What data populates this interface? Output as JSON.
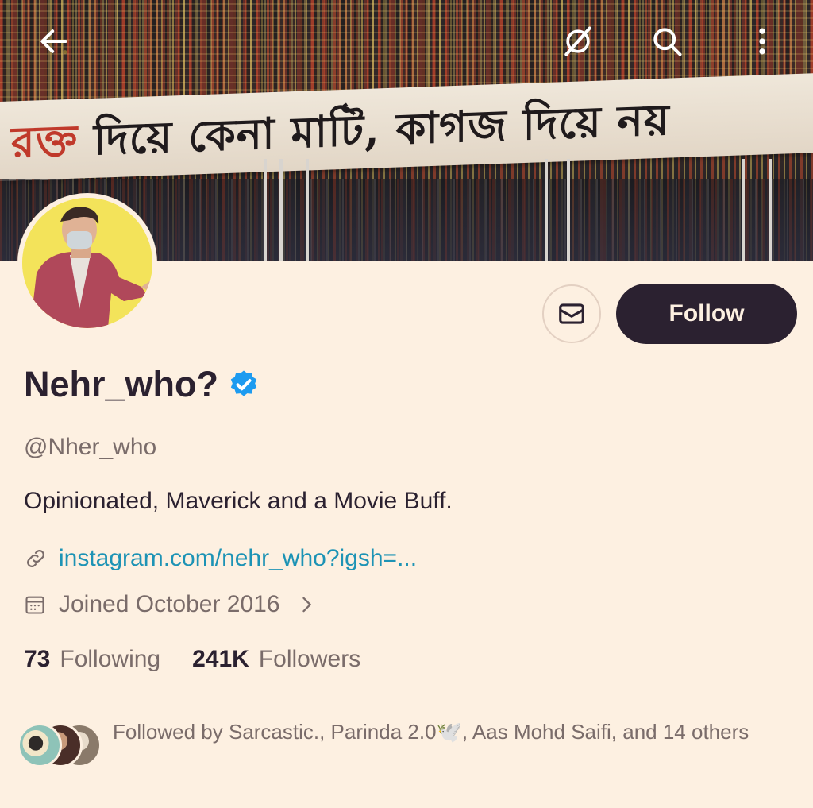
{
  "header": {
    "back_icon": "arrow-left-icon",
    "grok_icon": "grok-icon",
    "search_icon": "search-icon",
    "more_icon": "more-vertical-icon"
  },
  "banner": {
    "text_red": "রক্ত",
    "text": " দিয়ে কেনা মাটি, কাগজ দিয়ে নয়"
  },
  "actions": {
    "message_icon": "envelope-icon",
    "follow_label": "Follow"
  },
  "profile": {
    "display_name": "Nehr_who?",
    "verified": true,
    "handle": "@Nher_who",
    "bio": "Opinionated, Maverick and a Movie Buff.",
    "link": "instagram.com/nehr_who?igsh=...",
    "joined": "Joined October 2016"
  },
  "stats": {
    "following_count": "73",
    "following_label": "Following",
    "followers_count": "241K",
    "followers_label": "Followers"
  },
  "followed_by": {
    "text": "Followed by Sarcastic., Parinda 2.0🕊️, Aas Mohd Saifi, and 14 others"
  },
  "colors": {
    "background": "#fdf0e1",
    "primary_text": "#2b2130",
    "secondary_text": "#7a6c6a",
    "link": "#1d93b5",
    "verified": "#1d9bf0"
  }
}
